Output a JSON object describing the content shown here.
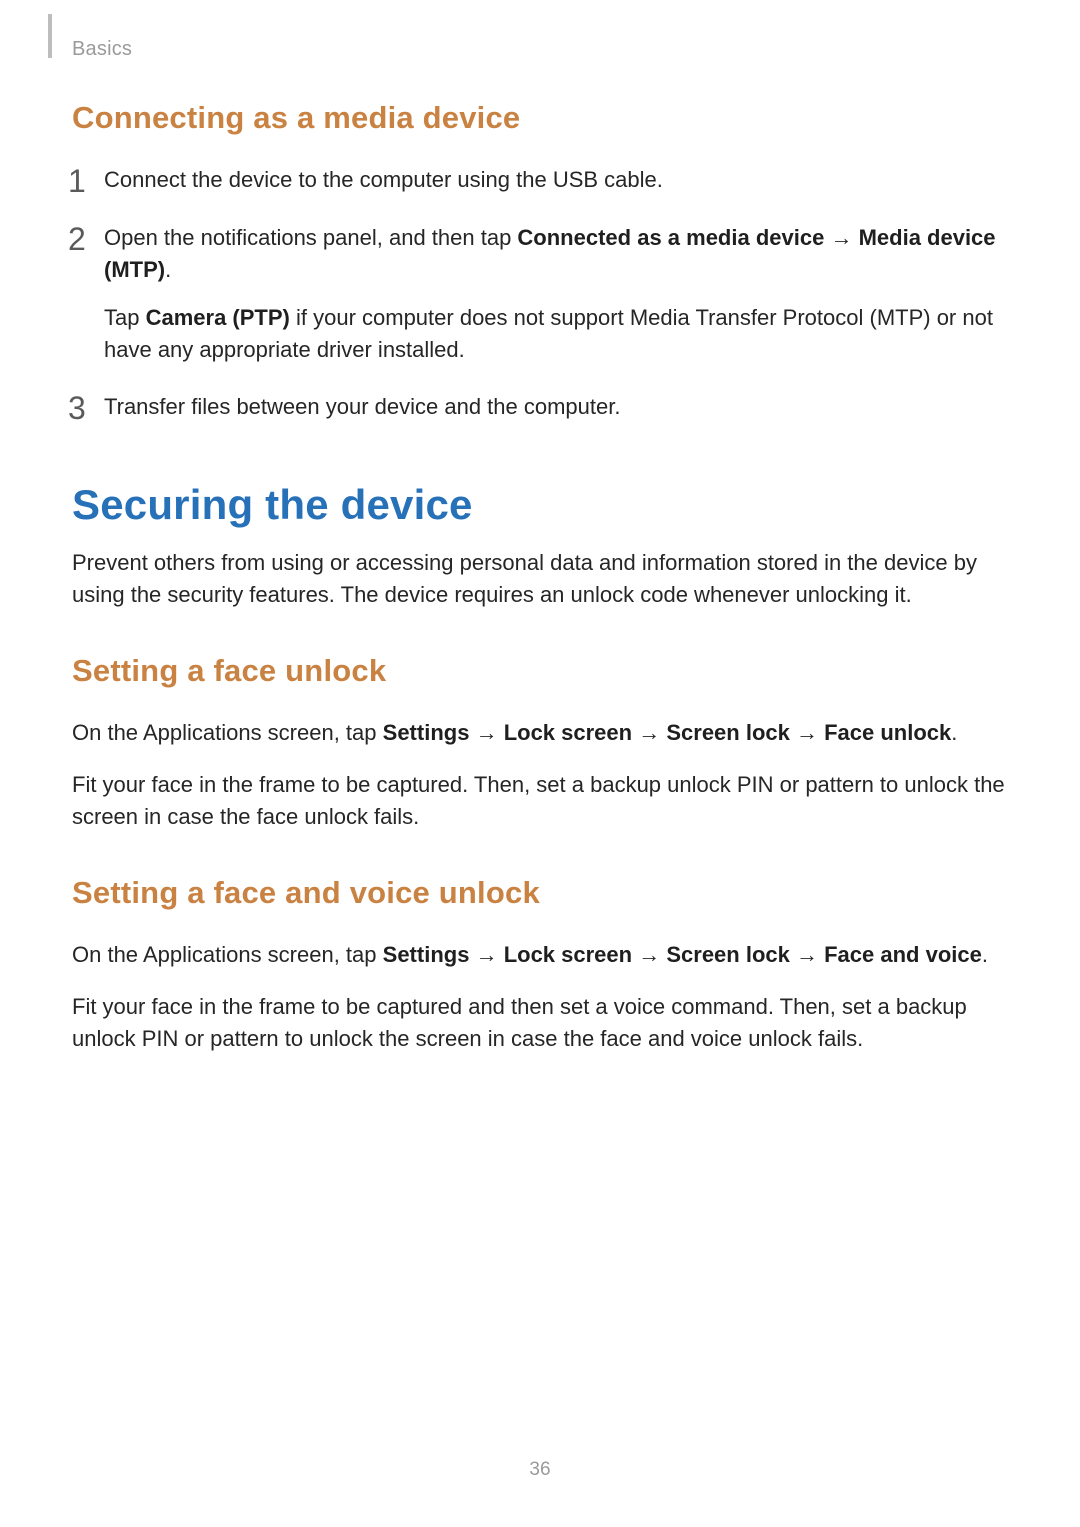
{
  "breadcrumb": "Basics",
  "page_number": "36",
  "arrow": "→",
  "section1": {
    "title": "Connecting as a media device",
    "steps": {
      "s1": "Connect the device to the computer using the USB cable.",
      "s2_pre": "Open the notifications panel, and then tap ",
      "s2_b1": "Connected as a media device",
      "s2_mid": " ",
      "s2_b2": "Media device (MTP)",
      "s2_post": ".",
      "s2_sub_pre": "Tap ",
      "s2_sub_b": "Camera (PTP)",
      "s2_sub_post": " if your computer does not support Media Transfer Protocol (MTP) or not have any appropriate driver installed.",
      "s3": "Transfer files between your device and the computer."
    }
  },
  "section2": {
    "title": "Securing the device",
    "intro": "Prevent others from using or accessing personal data and information stored in the device by using the security features. The device requires an unlock code whenever unlocking it.",
    "sub1": {
      "title": "Setting a face unlock",
      "p1_pre": "On the Applications screen, tap ",
      "p1_b1": "Settings",
      "p1_b2": "Lock screen",
      "p1_b3": "Screen lock",
      "p1_b4": "Face unlock",
      "p1_post": ".",
      "p2": "Fit your face in the frame to be captured. Then, set a backup unlock PIN or pattern to unlock the screen in case the face unlock fails."
    },
    "sub2": {
      "title": "Setting a face and voice unlock",
      "p1_pre": "On the Applications screen, tap ",
      "p1_b1": "Settings",
      "p1_b2": "Lock screen",
      "p1_b3": "Screen lock",
      "p1_b4": "Face and voice",
      "p1_post": ".",
      "p2": "Fit your face in the frame to be captured and then set a voice command. Then, set a backup unlock PIN or pattern to unlock the screen in case the face and voice unlock fails."
    }
  }
}
